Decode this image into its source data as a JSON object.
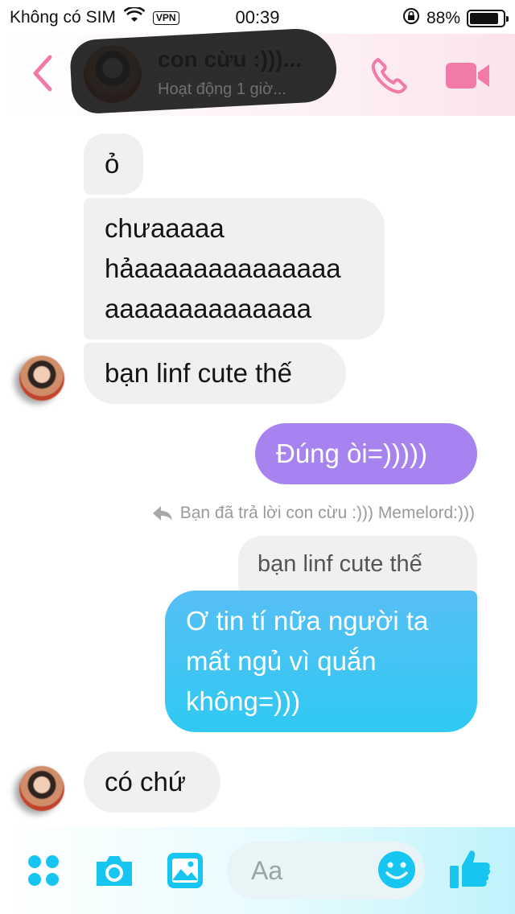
{
  "status_bar": {
    "carrier": "Không có SIM",
    "vpn": "VPN",
    "time": "00:39",
    "battery_percent": "88%",
    "battery_level": 0.88,
    "icons": [
      "wifi-icon",
      "rotation-lock-icon",
      "battery-icon"
    ]
  },
  "header": {
    "contact_name": "con cừu :)))...",
    "contact_status": "Hoạt động 1 giờ...",
    "icons": [
      "back-chevron-icon",
      "phone-icon",
      "video-camera-icon"
    ],
    "accent_color": "#f27aa8"
  },
  "messages": [
    {
      "from": "them",
      "lines": [
        "ỏ"
      ]
    },
    {
      "from": "them",
      "lines": [
        "chưaaaaa",
        "hảaaaaaaaaaaaaaa",
        "aaaaaaaaaaaaaa"
      ]
    },
    {
      "from": "them",
      "lines": [
        "bạn linf cute thế"
      ]
    },
    {
      "from": "me",
      "lines": [
        "Đúng òi=)))))"
      ],
      "color": "#a683ef"
    },
    {
      "from": "me",
      "reply_notice": "Bạn đã trả lời con cừu :))) Memelord:)))",
      "quoted": "bạn linf cute thế",
      "lines": [
        "Ơ tin tí nữa người ta",
        "mất ngủ vì quắn",
        "không=)))"
      ],
      "color": "#3fc4f4"
    },
    {
      "from": "them",
      "lines": [
        "có chứ"
      ]
    }
  ],
  "composer": {
    "placeholder": "Aa",
    "icons": [
      "apps-grid-icon",
      "camera-icon",
      "image-icon",
      "emoji-icon",
      "thumbs-up-icon"
    ],
    "accent_color": "#16c6f0"
  }
}
